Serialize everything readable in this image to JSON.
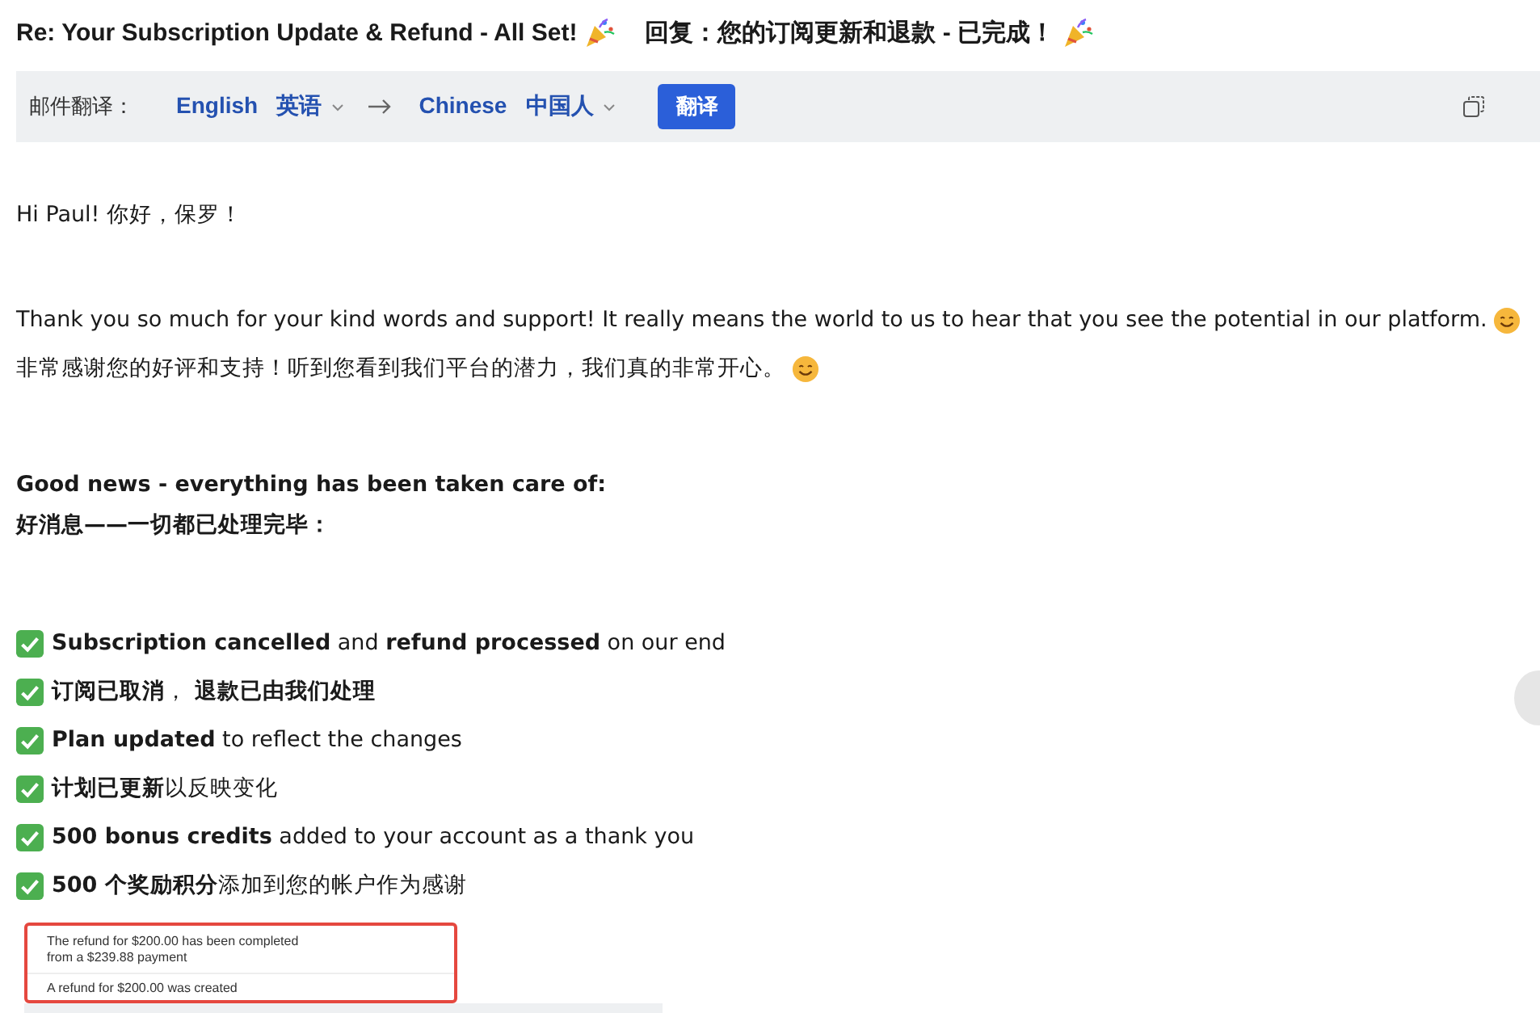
{
  "subject": {
    "en": "Re: Your Subscription Update & Refund - All Set!",
    "zh": "回复：您的订阅更新和退款 - 已完成！"
  },
  "translate_bar": {
    "label": "邮件翻译：",
    "source": {
      "en": "English",
      "native": "英语"
    },
    "target": {
      "en": "Chinese",
      "native": "中国人"
    },
    "button": "翻译"
  },
  "body": [
    {
      "lines": [
        {
          "text": "Hi Paul!  你好，保罗！"
        }
      ]
    },
    {
      "lines": [
        {
          "text": "Thank you so much for your kind words and support! It really means the world to us to hear that you see the potential in our platform.",
          "smile": true
        },
        {
          "text": "非常感谢您的好评和支持！听到您看到我们平台的潜力，我们真的非常开心。",
          "smile": true
        }
      ]
    },
    {
      "lines": [
        {
          "text": "Good news - everything has been taken care of:",
          "bold": true
        },
        {
          "text": "好消息——一切都已处理完毕：",
          "bold": true
        }
      ]
    },
    {
      "lines": [
        {
          "text": "**Subscription cancelled** and **refund processed** on our end",
          "check": true
        },
        {
          "text": "**订阅已取消**， **退款已由我们处理**",
          "check": true
        },
        {
          "text": "**Plan updated** to reflect the changes",
          "check": true
        },
        {
          "text": "**计划已更新**以反映变化",
          "check": true
        },
        {
          "text": "**500 bonus credits** added to your account as a thank you",
          "check": true
        },
        {
          "text": "**500 个奖励积分**添加到您的帐户作为感谢",
          "check": true
        }
      ]
    }
  ],
  "attachment": {
    "lines": [
      "The refund for $200.00 has been completed",
      "from a $239.88 payment"
    ],
    "footer": "A refund for $200.00 was created"
  }
}
